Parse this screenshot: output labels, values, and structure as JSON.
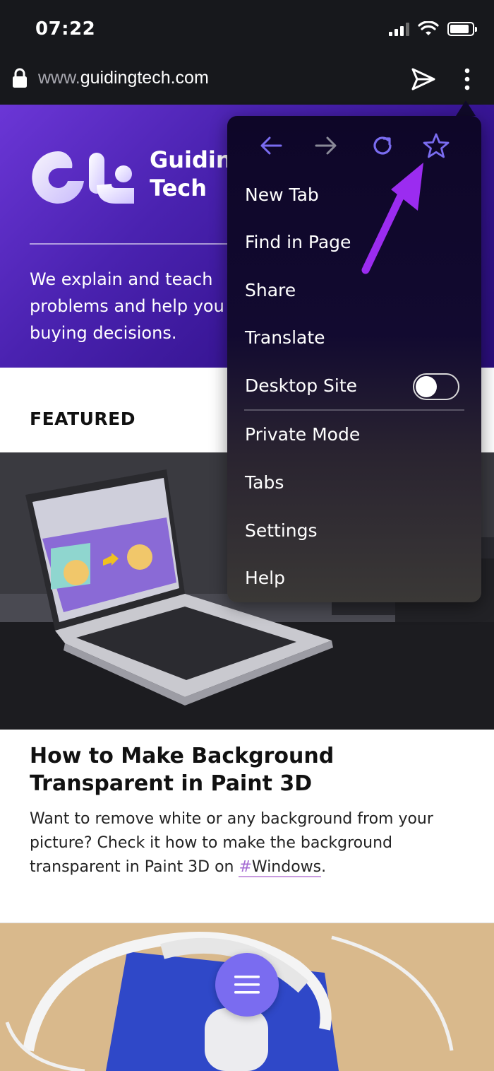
{
  "status": {
    "time": "07:22"
  },
  "address_bar": {
    "url_prefix": "www.",
    "url_domain": "guidingtech.com"
  },
  "hero": {
    "brand_name": "Guidin\nTech",
    "tagline_lines": [
      "We explain and teach",
      "problems and help you",
      "buying decisions."
    ]
  },
  "featured": {
    "section_label": "FEATURED",
    "article_title": "How to Make Background Transparent in Paint 3D",
    "article_desc_prefix": "Want to remove white or any background from your picture? Check it how to make the background transparent in Paint 3D on ",
    "hashtag_mark": "#",
    "hashtag_text": "Windows",
    "article_desc_suffix": "."
  },
  "menu": {
    "items": [
      "New Tab",
      "Find in Page",
      "Share",
      "Translate",
      "Desktop Site",
      "Private Mode",
      "Tabs",
      "Settings",
      "Help"
    ],
    "desktop_site_enabled": false,
    "icons": [
      "back-arrow-icon",
      "forward-arrow-icon",
      "reload-icon",
      "bookmark-star-icon"
    ]
  },
  "colors": {
    "accent": "#7a6cf0",
    "annotation": "#9b2cf0",
    "hero_start": "#6b36d6",
    "hero_end": "#2a0e7a"
  }
}
